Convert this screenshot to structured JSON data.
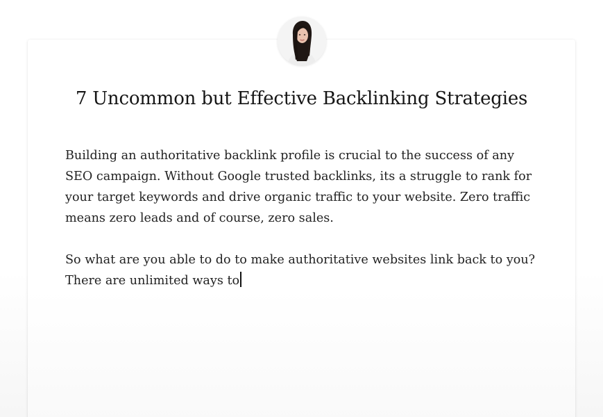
{
  "document": {
    "title": "7 Uncommon but Effective Backlinking Strategies",
    "paragraphs": [
      "Building an authoritative backlink profile is crucial to the success of any SEO campaign. Without Google trusted backlinks, its a struggle to rank for your target keywords and drive organic traffic to your website. Zero traffic means zero leads and of course, zero sales.",
      "So what are you able to do to make authoritative websites link back to you? There are unlimited ways to"
    ]
  },
  "author": {
    "avatar_icon": "author-avatar"
  }
}
